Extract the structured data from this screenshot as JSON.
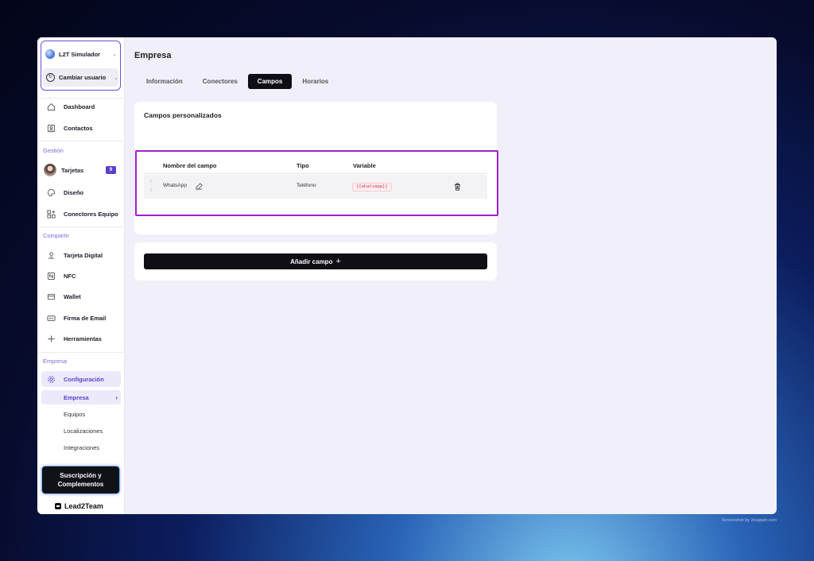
{
  "account": {
    "company_name": "L2T Simulador",
    "change_user_label": "Cambiar usuario"
  },
  "sidebar": {
    "top_items": [
      {
        "label": "Dashboard",
        "icon": "home-icon"
      },
      {
        "label": "Contactos",
        "icon": "contacts-icon"
      }
    ],
    "sections": {
      "gestion": "Gestión",
      "compartir": "Compartir",
      "empresa": "Empresa"
    },
    "gestion_items": [
      {
        "label": "Tarjetas",
        "badge": "9"
      },
      {
        "label": "Diseño",
        "icon": "palette-icon"
      },
      {
        "label": "Conectores Equipo",
        "icon": "grid-plus-icon"
      }
    ],
    "compartir_items": [
      {
        "label": "Tarjeta Digital",
        "icon": "id-card-icon"
      },
      {
        "label": "NFC",
        "icon": "nfc-icon"
      },
      {
        "label": "Wallet",
        "icon": "wallet-icon"
      },
      {
        "label": "Firma de Email",
        "icon": "email-signature-icon"
      },
      {
        "label": "Herramientas",
        "icon": "plus-icon"
      }
    ],
    "empresa_items": {
      "configuracion": "Configuración",
      "sub": [
        "Empresa",
        "Equipos",
        "Localizaciones",
        "Integraciones"
      ]
    },
    "subscription_label_1": "Suscripción y",
    "subscription_label_2": "Complementos",
    "brand_name": "Lead2Team"
  },
  "main": {
    "title": "Empresa",
    "tabs": [
      "Información",
      "Conectores",
      "Campos",
      "Horarios"
    ],
    "active_tab": "Campos",
    "custom_fields": {
      "title": "Campos personalizados",
      "columns": [
        "Nombre del campo",
        "Tipo",
        "Variable"
      ],
      "rows": [
        {
          "name": "WhatsApp",
          "type": "Teléfono",
          "variable": "{{whatsapp}}"
        }
      ]
    },
    "add_field_label": "Añadir campo"
  },
  "credit": "Screenshot by Xnapper.com",
  "colors": {
    "accent": "#5b3fd0",
    "highlight_border": "#a020c8",
    "button_dark": "#0e0e14"
  }
}
